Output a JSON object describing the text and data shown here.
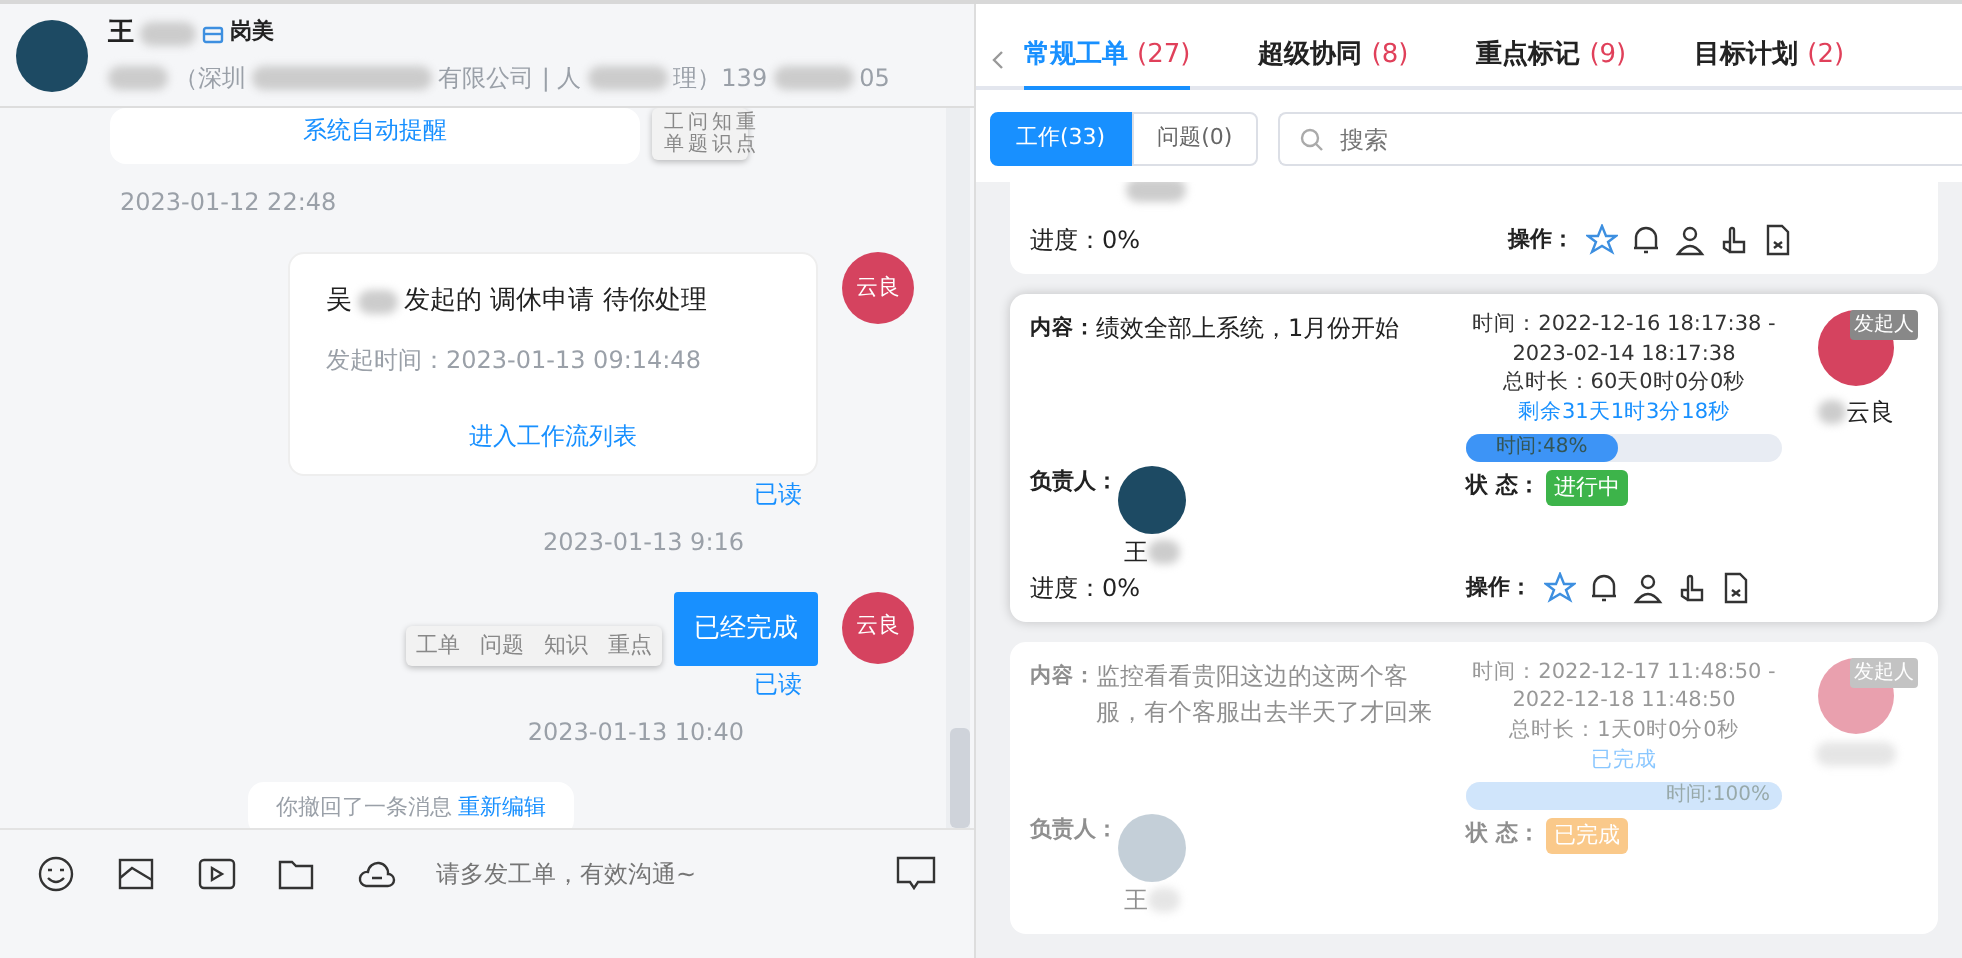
{
  "chat": {
    "contact": {
      "name": "王",
      "role": "岗美",
      "subtitle_parts": [
        "（深圳",
        "有限公司 | 人",
        "理）139",
        "05"
      ]
    },
    "messages": [
      {
        "kind": "card_partial",
        "link": "系统自动提醒",
        "menu": [
          "工单",
          "问题",
          "知识",
          "重点"
        ]
      },
      {
        "kind": "time_left",
        "text": "2023-01-12 22:48"
      },
      {
        "kind": "workflow",
        "prefix": "吴",
        "title": "发起的 调休申请 待你处理",
        "sent_at": "发起时间：2023-01-13 09:14:48",
        "link": "进入工作流列表",
        "avatar": "云良",
        "read": "已读"
      },
      {
        "kind": "time",
        "text": "2023-01-13 9:16"
      },
      {
        "kind": "text",
        "text": "已经完成",
        "menu": [
          "工单",
          "问题",
          "知识",
          "重点"
        ],
        "avatar": "云良",
        "read": "已读"
      },
      {
        "kind": "time",
        "text": "2023-01-13 10:40"
      },
      {
        "kind": "notice",
        "text": "你撤回了一条消息",
        "link": "重新编辑"
      }
    ],
    "composer": {
      "placeholder": "请多发工单，有效沟通~"
    }
  },
  "orders": {
    "tabs": [
      {
        "label": "常规工单",
        "count": "(27)",
        "selected": true
      },
      {
        "label": "超级协同",
        "count": "(8)",
        "selected": false
      },
      {
        "label": "重点标记",
        "count": "(9)",
        "selected": false
      },
      {
        "label": "目标计划",
        "count": "(2)",
        "selected": false
      }
    ],
    "segments": [
      {
        "label": "工作(33)",
        "selected": true
      },
      {
        "label": "问题(0)",
        "selected": false
      }
    ],
    "search": {
      "placeholder": "搜索"
    },
    "cards": [
      {
        "kind": "partial",
        "progress": "进度：0%",
        "actions_label": "操作："
      },
      {
        "kind": "full",
        "dimmed": false,
        "content_label": "内容：",
        "content": "绩效全部上系统，1月份开始",
        "time_1": "时间：2022-12-16 18:17:38 -",
        "time_2": "2023-02-14 18:17:38",
        "total": "总时长：60天0时0分0秒",
        "remaining": "剩余31天1时3分18秒",
        "level": 0.48,
        "bar_text": "时间:48%",
        "assignee_label": "负责人：",
        "assignee": "王",
        "status_label": "状 态：",
        "status": "进行中",
        "color": "#3db44a",
        "initiator_tag": "发起人",
        "initiator": "云良",
        "progress": "进度：0%",
        "actions_label": "操作："
      },
      {
        "kind": "full",
        "dimmed": true,
        "content_label": "内容：",
        "content": "监控看看贵阳这边的这两个客服，有个客服出去半天了才回来",
        "time_1": "时间：2022-12-17 11:48:50 -",
        "time_2": "2022-12-18 11:48:50",
        "total": "总时长：1天0时0分0秒",
        "remaining": "已完成",
        "level": 1,
        "bar_text": "时间:100%",
        "assignee_label": "负责人：",
        "assignee": "王",
        "status_label": "状 态：",
        "status": "已完成",
        "color": "#fac98a",
        "initiator_tag": "发起人"
      }
    ]
  }
}
